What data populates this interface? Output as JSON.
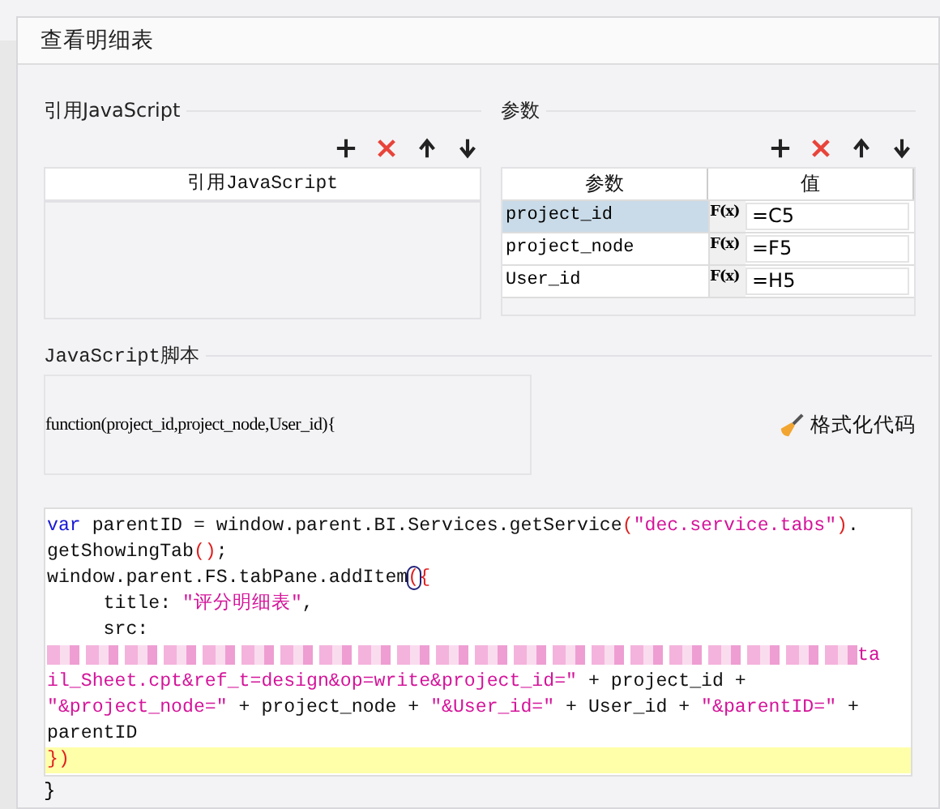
{
  "window": {
    "title": "查看明细表"
  },
  "js_references": {
    "legend": "引用JavaScript",
    "toolbar": [
      {
        "kind": "add"
      },
      {
        "kind": "delete"
      },
      {
        "kind": "up"
      },
      {
        "kind": "down"
      }
    ],
    "columns": [
      "引用JavaScript"
    ]
  },
  "parameters": {
    "legend": "参数",
    "toolbar": [
      {
        "kind": "add"
      },
      {
        "kind": "delete"
      },
      {
        "kind": "up"
      },
      {
        "kind": "down"
      }
    ],
    "columns": [
      "参数",
      "值"
    ],
    "rows": [
      {
        "name": "project_id",
        "formula_icon": "F(x)",
        "value": "=C5",
        "selected": true
      },
      {
        "name": "project_node",
        "formula_icon": "F(x)",
        "value": "=F5",
        "selected": false
      },
      {
        "name": "User_id",
        "formula_icon": "F(x)",
        "value": "=H5",
        "selected": false
      }
    ]
  },
  "script": {
    "legend": "JavaScript脚本",
    "signature": "function(project_id,project_node,User_id){",
    "format_button": "格式化代码",
    "lines": [
      {
        "highlighted": false,
        "segments": [
          {
            "kind": "keyword",
            "text": "var"
          },
          {
            "kind": "plain",
            "text": " parentID = window.parent.BI.Services.getService"
          },
          {
            "kind": "paren",
            "text": "("
          },
          {
            "kind": "string",
            "text": "\"dec.service.tabs\""
          },
          {
            "kind": "paren",
            "text": ")"
          },
          {
            "kind": "plain",
            "text": "."
          }
        ]
      },
      {
        "highlighted": false,
        "segments": [
          {
            "kind": "plain",
            "text": "getShowingTab"
          },
          {
            "kind": "paren",
            "text": "()"
          },
          {
            "kind": "plain",
            "text": ";"
          }
        ]
      },
      {
        "highlighted": false,
        "segments": [
          {
            "kind": "plain",
            "text": "window.parent.FS.tabPane.addItem"
          },
          {
            "kind": "matched",
            "text": "("
          },
          {
            "kind": "paren",
            "text": "{"
          }
        ]
      },
      {
        "highlighted": false,
        "segments": [
          {
            "kind": "plain",
            "text": "     title: "
          },
          {
            "kind": "string",
            "text": "\"评分明细表\""
          },
          {
            "kind": "plain",
            "text": ","
          }
        ]
      },
      {
        "highlighted": false,
        "segments": [
          {
            "kind": "plain",
            "text": "     src:"
          }
        ]
      },
      {
        "highlighted": false,
        "segments": [
          {
            "kind": "redacted"
          },
          {
            "kind": "string",
            "text": "ta"
          }
        ]
      },
      {
        "highlighted": false,
        "segments": [
          {
            "kind": "string",
            "text": "il_Sheet.cpt&ref_t=design&op=write&project_id=\""
          },
          {
            "kind": "plain",
            "text": " + project_id +"
          }
        ]
      },
      {
        "highlighted": false,
        "segments": [
          {
            "kind": "string",
            "text": "\"&project_node=\""
          },
          {
            "kind": "plain",
            "text": " + project_node + "
          },
          {
            "kind": "string",
            "text": "\"&User_id=\""
          },
          {
            "kind": "plain",
            "text": " + User_id + "
          },
          {
            "kind": "string",
            "text": "\"&parentID=\""
          },
          {
            "kind": "plain",
            "text": " +"
          }
        ]
      },
      {
        "highlighted": false,
        "segments": [
          {
            "kind": "plain",
            "text": "parentID"
          }
        ]
      },
      {
        "highlighted": true,
        "segments": [
          {
            "kind": "paren",
            "text": "})"
          }
        ]
      }
    ],
    "closing": "}"
  }
}
